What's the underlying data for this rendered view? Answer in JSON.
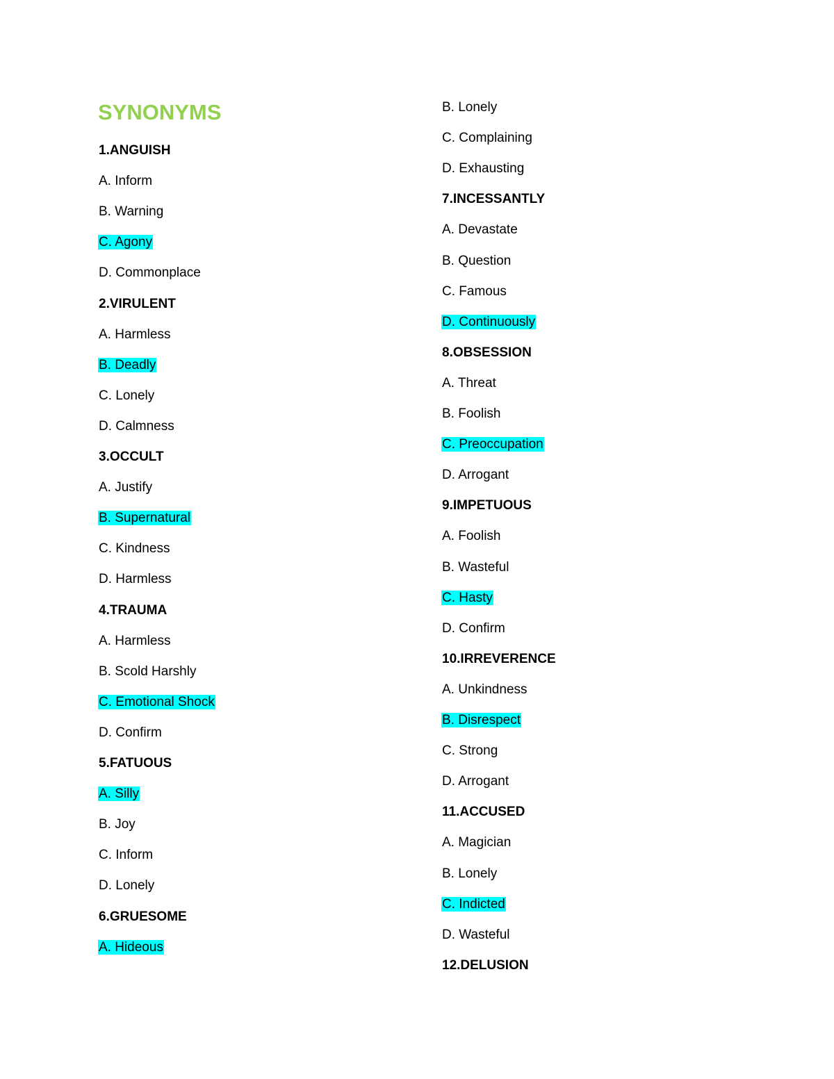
{
  "title": "SYNONYMS",
  "highlight_color": "#00FFFF",
  "title_color": "#92D050",
  "questions": [
    {
      "number": "1",
      "word": "1.ANGUISH",
      "options": [
        "A. Inform",
        "B. Warning",
        "C. Agony",
        "D. Commonplace"
      ],
      "answer_index": 2
    },
    {
      "number": "2",
      "word": "2.VIRULENT",
      "options": [
        "A. Harmless",
        "B. Deadly",
        "C. Lonely",
        "D. Calmness"
      ],
      "answer_index": 1
    },
    {
      "number": "3",
      "word": "3.OCCULT",
      "options": [
        "A. Justify",
        "B. Supernatural",
        "C. Kindness",
        "D. Harmless"
      ],
      "answer_index": 1
    },
    {
      "number": "4",
      "word": "4.TRAUMA",
      "options": [
        "A. Harmless",
        "B. Scold Harshly",
        "C. Emotional Shock",
        "D. Confirm"
      ],
      "answer_index": 2
    },
    {
      "number": "5",
      "word": "5.FATUOUS",
      "options": [
        "A. Silly",
        "B. Joy",
        "C. Inform",
        "D. Lonely"
      ],
      "answer_index": 0
    },
    {
      "number": "6",
      "word": "6.GRUESOME",
      "options": [
        "A. Hideous",
        "B. Lonely",
        "C. Complaining",
        "D. Exhausting"
      ],
      "answer_index": 0
    },
    {
      "number": "7",
      "word": "7.INCESSANTLY",
      "options": [
        "A. Devastate",
        "B. Question",
        "C. Famous",
        "D. Continuously"
      ],
      "answer_index": 3
    },
    {
      "number": "8",
      "word": "8.OBSESSION",
      "options": [
        "A. Threat",
        "B. Foolish",
        "C. Preoccupation",
        "D. Arrogant"
      ],
      "answer_index": 2
    },
    {
      "number": "9",
      "word": "9.IMPETUOUS",
      "options": [
        "A. Foolish",
        "B. Wasteful",
        "C. Hasty",
        "D. Confirm"
      ],
      "answer_index": 2
    },
    {
      "number": "10",
      "word": "10.IRREVERENCE",
      "options": [
        "A. Unkindness",
        "B. Disrespect",
        "C. Strong",
        "D. Arrogant"
      ],
      "answer_index": 1
    },
    {
      "number": "11",
      "word": "11.ACCUSED",
      "options": [
        "A. Magician",
        "B. Lonely",
        "C. Indicted",
        "D. Wasteful"
      ],
      "answer_index": 2
    },
    {
      "number": "12",
      "word": "12.DELUSION",
      "options": [],
      "answer_index": null
    }
  ]
}
